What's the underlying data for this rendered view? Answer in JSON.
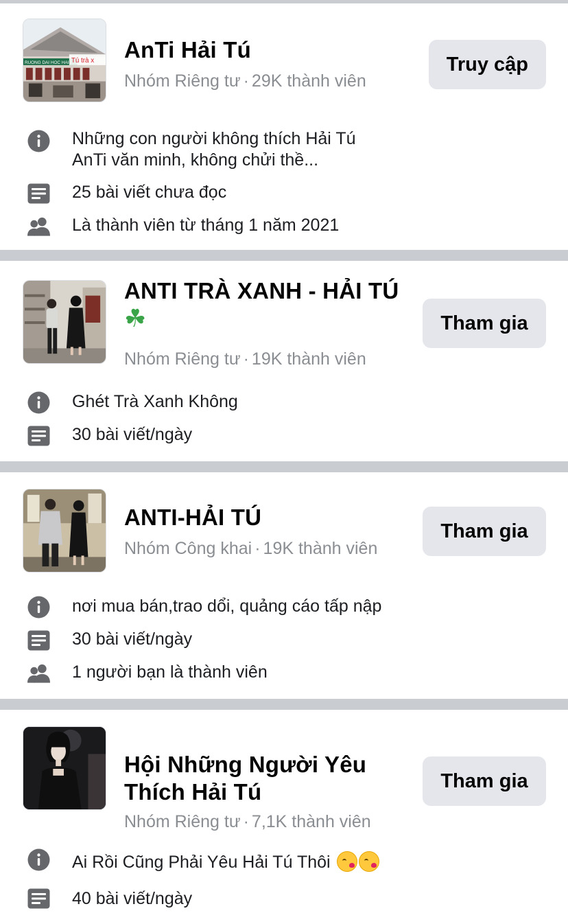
{
  "groups": [
    {
      "name": "AnTi Hải Tú",
      "privacy": "Nhóm Riêng tư",
      "members": "29K thành viên",
      "button": "Truy cập",
      "thumb_text": "Tú trà x",
      "thumb_sign": "RUONG DAI HOC HAI",
      "details": [
        {
          "icon": "info-icon",
          "text_lines": [
            "Những con người không thích Hải Tú",
            "AnTi văn minh, không chửi thề..."
          ]
        },
        {
          "icon": "posts-icon",
          "text": "25 bài viết chưa đọc"
        },
        {
          "icon": "members-icon",
          "text": "Là thành viên từ tháng 1 năm 2021"
        }
      ]
    },
    {
      "name": "ANTI TRÀ XANH - HẢI TÚ",
      "name_emoji": "☘",
      "privacy": "Nhóm Riêng tư",
      "members": "19K thành viên",
      "button": "Tham gia",
      "details": [
        {
          "icon": "info-icon",
          "text": "Ghét Trà Xanh Không"
        },
        {
          "icon": "posts-icon",
          "text": "30 bài viết/ngày"
        }
      ]
    },
    {
      "name": "ANTI-HẢI TÚ",
      "privacy": "Nhóm Công khai",
      "members": "19K thành viên",
      "button": "Tham gia",
      "details": [
        {
          "icon": "info-icon",
          "text": "nơi mua bán,trao dổi, quảng cáo tấp nập"
        },
        {
          "icon": "posts-icon",
          "text": "30 bài viết/ngày"
        },
        {
          "icon": "members-icon",
          "text": "1 người bạn là thành viên"
        }
      ]
    },
    {
      "name_lines": [
        "Hội Những Người Yêu",
        "Thích Hải Tú"
      ],
      "privacy": "Nhóm Riêng tư",
      "members": "7,1K thành viên",
      "button": "Tham gia",
      "details": [
        {
          "icon": "info-icon",
          "text": "Ai Rồi Cũng Phải Yêu Hải Tú Thôi",
          "emojis": [
            "kissing-face-emoji",
            "kissing-face-emoji"
          ]
        },
        {
          "icon": "posts-icon",
          "text": "40 bài viết/ngày"
        }
      ]
    }
  ],
  "separator": "·",
  "colors": {
    "button_bg": "#e4e6eb",
    "meta_text": "#8a8d91",
    "icon": "#65676b",
    "separator": "#c9ccd1"
  }
}
